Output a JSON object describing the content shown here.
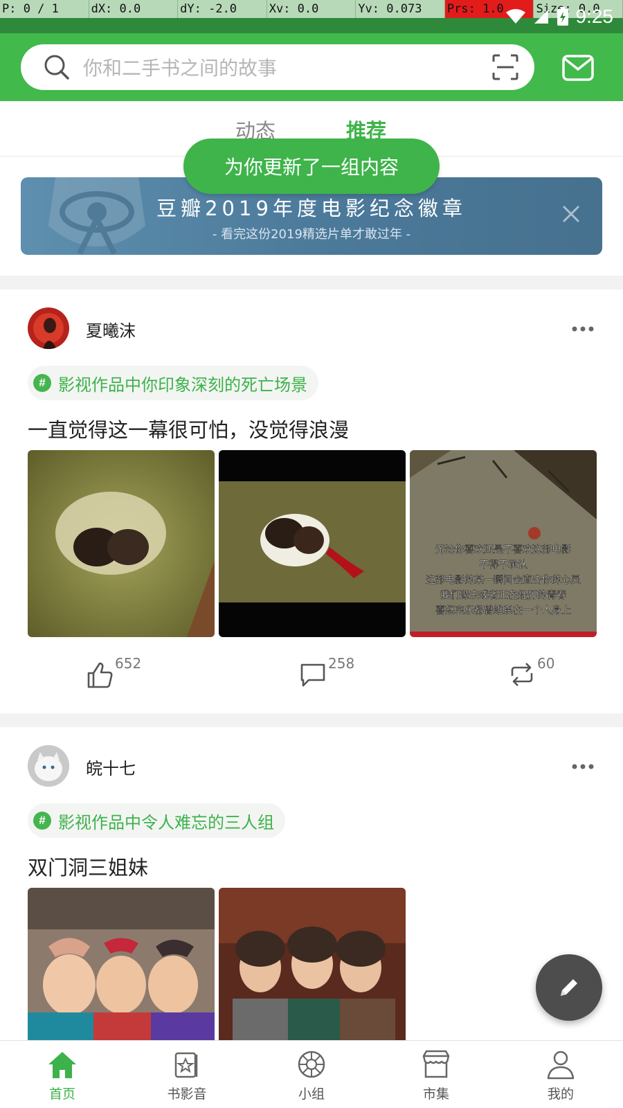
{
  "debug": {
    "cells": [
      "P: 0 / 1",
      "dX: 0.0",
      "dY: -2.0",
      "Xv: 0.0",
      "Yv: 0.073",
      "Prs: 1.0",
      "Size: 0.0"
    ]
  },
  "status": {
    "time": "9:25"
  },
  "search": {
    "placeholder": "你和二手书之间的故事"
  },
  "tabs": {
    "dynamic": "动态",
    "recommend": "推荐"
  },
  "toast": "为你更新了一组内容",
  "banner": {
    "title": "豆瓣2019年度电影纪念徽章",
    "subtitle": "- 看完这份2019精选片单才敢过年 -"
  },
  "posts": [
    {
      "username": "夏曦沫",
      "topic": "影视作品中你印象深刻的死亡场景",
      "text": "一直觉得这一幕很可怕，没觉得浪漫",
      "image_caption": [
        "无论你喜欢还是不喜欢这部电影",
        "不得不承认",
        "这部电影的某一瞬间会直击你的心灵",
        "我们逝去或者正在经历的青春",
        "喜怒哀乐都曾维系在一个人身上"
      ],
      "likes": "652",
      "comments": "258",
      "reshares": "60"
    },
    {
      "username": "皖十七",
      "topic": "影视作品中令人难忘的三人组",
      "text": "双门洞三姐妹"
    }
  ],
  "nav": [
    {
      "label": "首页",
      "icon": "home-icon",
      "active": true
    },
    {
      "label": "书影音",
      "icon": "book-movie-icon",
      "active": false
    },
    {
      "label": "小组",
      "icon": "group-icon",
      "active": false
    },
    {
      "label": "市集",
      "icon": "market-icon",
      "active": false
    },
    {
      "label": "我的",
      "icon": "profile-icon",
      "active": false
    }
  ],
  "colors": {
    "brand": "#41b94b",
    "status_bar": "#2e8a3a",
    "fab": "#4d4d4d"
  }
}
